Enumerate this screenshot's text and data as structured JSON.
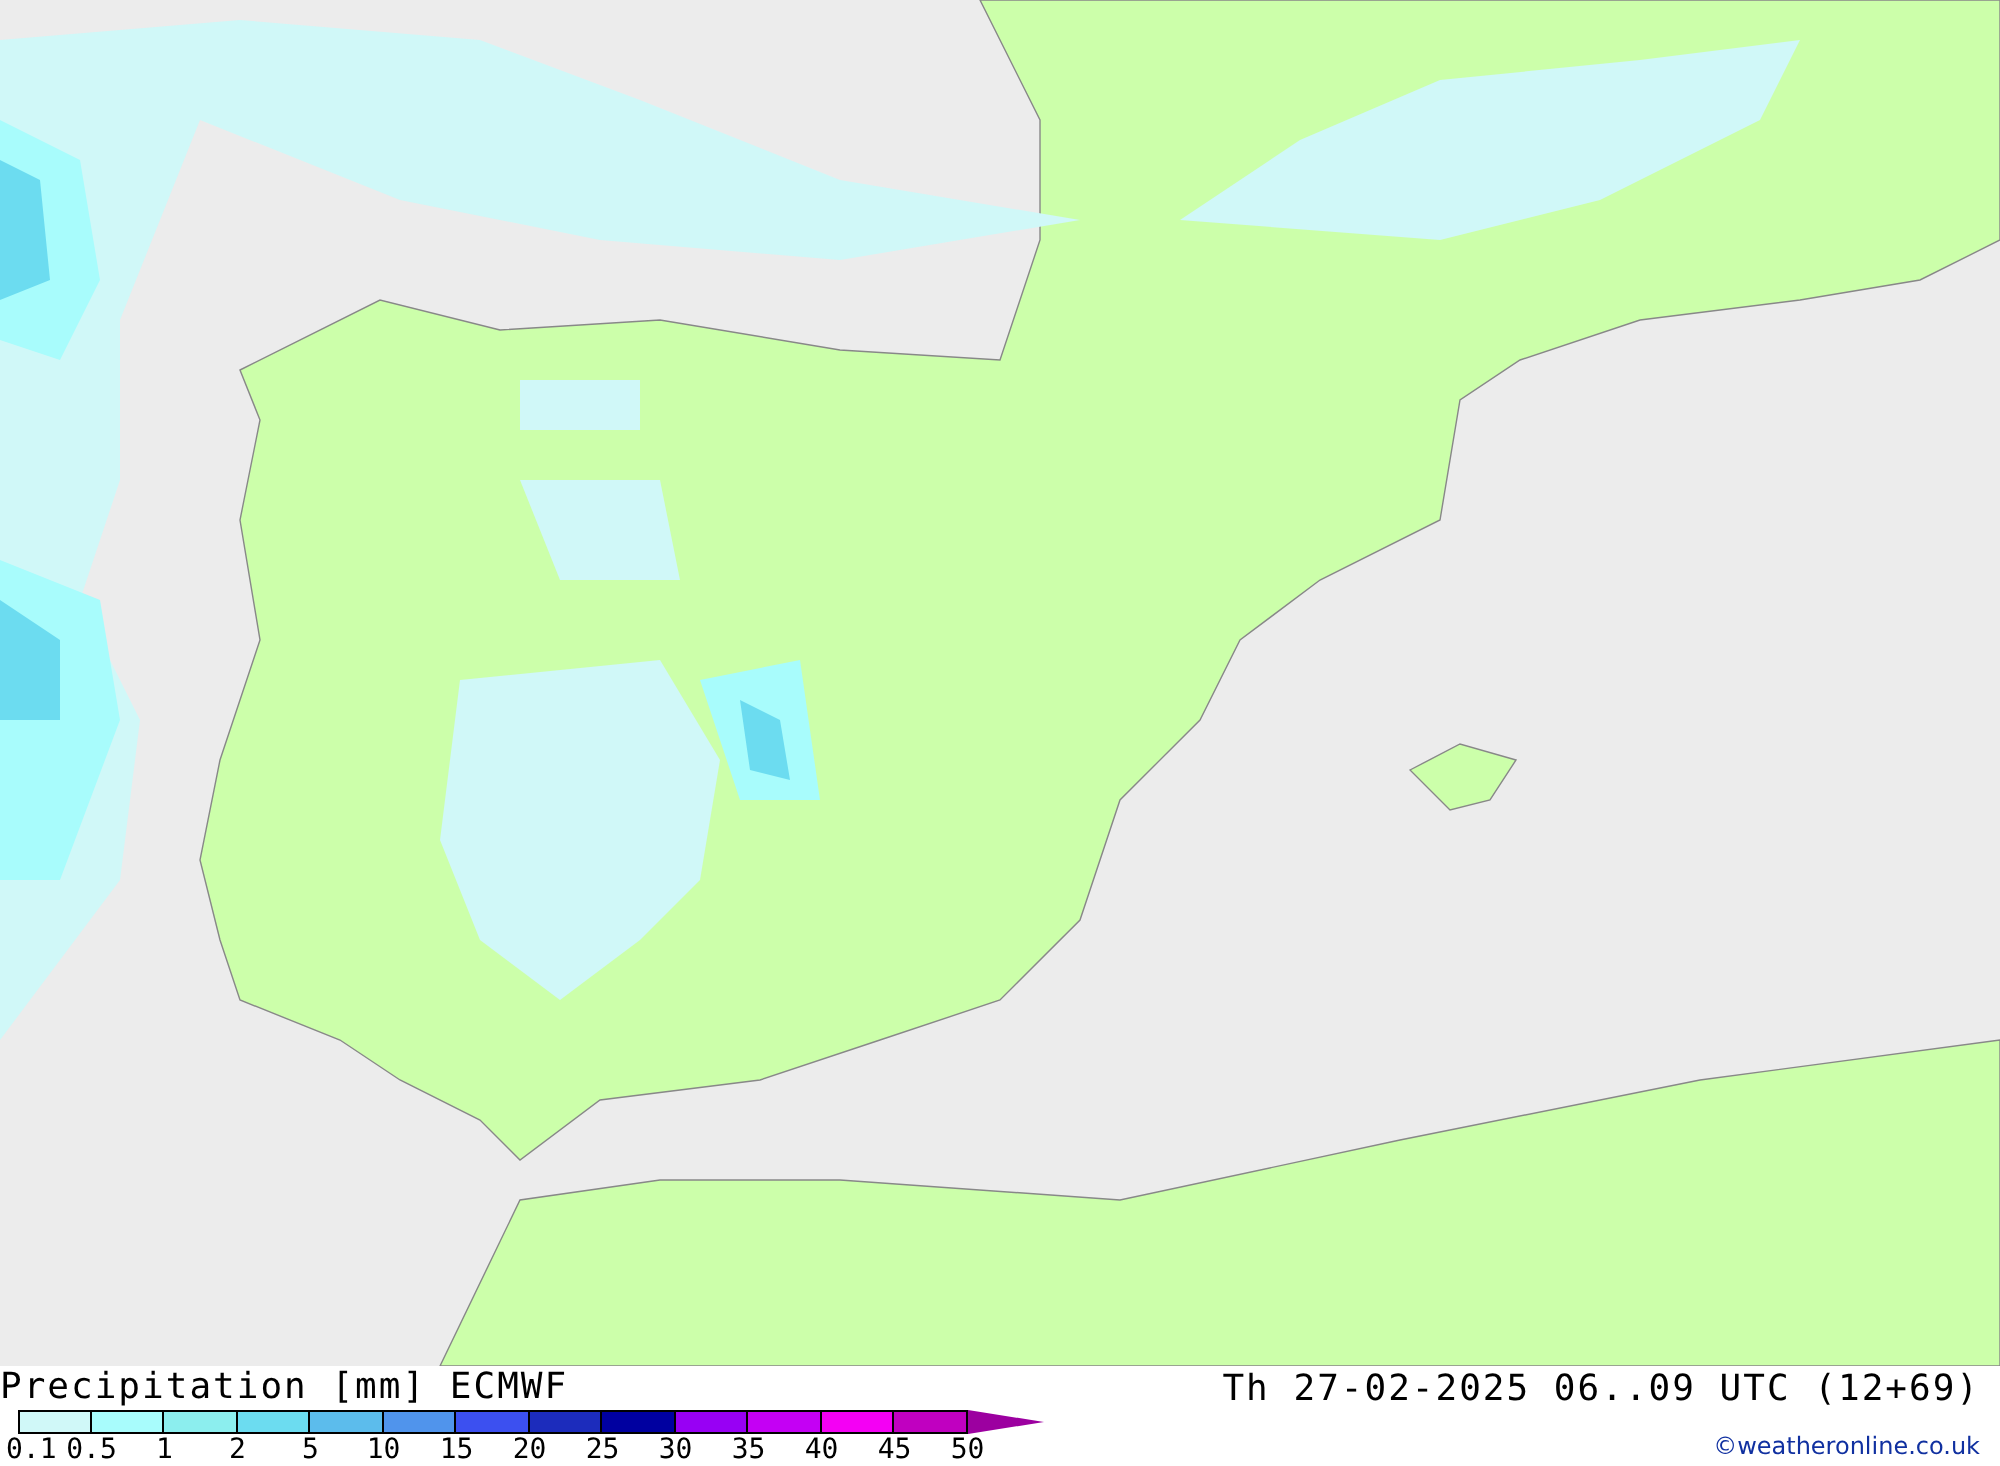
{
  "legend": {
    "title": "Precipitation [mm] ECMWF",
    "valid_time": "Th 27-02-2025 06..09 UTC (12+69)",
    "credit": "©weatheronline.co.uk",
    "scale_labels": [
      "0.1",
      "0.5",
      "1",
      "2",
      "5",
      "10",
      "15",
      "20",
      "25",
      "30",
      "35",
      "40",
      "45",
      "50"
    ],
    "swatches": [
      {
        "color": "#d0f8f8"
      },
      {
        "color": "#a8fcfc"
      },
      {
        "color": "#8ceeee"
      },
      {
        "color": "#6cdcf0"
      },
      {
        "color": "#5cbcec"
      },
      {
        "color": "#5094ec"
      },
      {
        "color": "#3c50f0"
      },
      {
        "color": "#1c2cbc"
      },
      {
        "color": "#0000a0"
      },
      {
        "color": "#9800f4"
      },
      {
        "color": "#c400f4"
      },
      {
        "color": "#f400f4"
      },
      {
        "color": "#c000c0"
      }
    ]
  }
}
